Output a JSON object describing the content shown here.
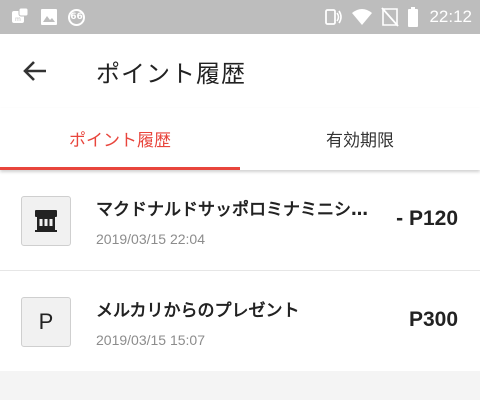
{
  "status_bar": {
    "badge": "66",
    "time": "22:12",
    "left_icons": [
      "mercari-notification-icon",
      "image-notification-icon",
      "badge-66-icon"
    ],
    "right_icons": [
      "nfc-icon",
      "wifi-icon",
      "no-sim-icon",
      "battery-icon"
    ]
  },
  "header": {
    "back_icon": "arrow-back-icon",
    "title": "ポイント履歴"
  },
  "tabs": [
    {
      "label": "ポイント履歴",
      "active": true
    },
    {
      "label": "有効期限",
      "active": false
    }
  ],
  "history": [
    {
      "icon": "store-icon",
      "icon_letter": "",
      "title": "マクドナルドサッポロミナミニシヨジョウテン",
      "date": "2019/03/15 22:04",
      "amount": "- P120"
    },
    {
      "icon": "letter-icon",
      "icon_letter": "P",
      "title": "メルカリからのプレゼント",
      "date": "2019/03/15 15:07",
      "amount": "P300"
    }
  ],
  "colors": {
    "accent": "#e8453c",
    "status_bar": "#bdbdbd",
    "text_primary": "#222222",
    "text_secondary": "#8c8c8c",
    "background": "#f4f4f4"
  }
}
